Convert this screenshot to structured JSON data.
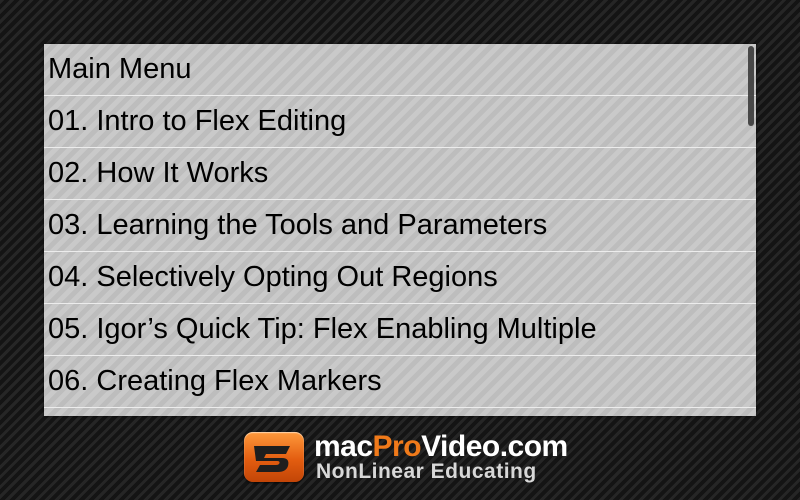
{
  "menu": {
    "header": "Main Menu",
    "items": [
      {
        "label": "01. Intro to Flex Editing"
      },
      {
        "label": "02. How It Works"
      },
      {
        "label": "03. Learning the Tools and Parameters"
      },
      {
        "label": "04. Selectively Opting Out Regions"
      },
      {
        "label": "05. Igor’s Quick Tip: Flex Enabling Multiple"
      },
      {
        "label": "06. Creating Flex Markers"
      }
    ]
  },
  "logo": {
    "brand_mac": "mac",
    "brand_pro": "Pro",
    "brand_rest": "Video.com",
    "tagline": "NonLinear Educating"
  },
  "colors": {
    "accent": "#f07a1a",
    "panel": "#c4c4c4",
    "background": "#1c1c1c"
  }
}
